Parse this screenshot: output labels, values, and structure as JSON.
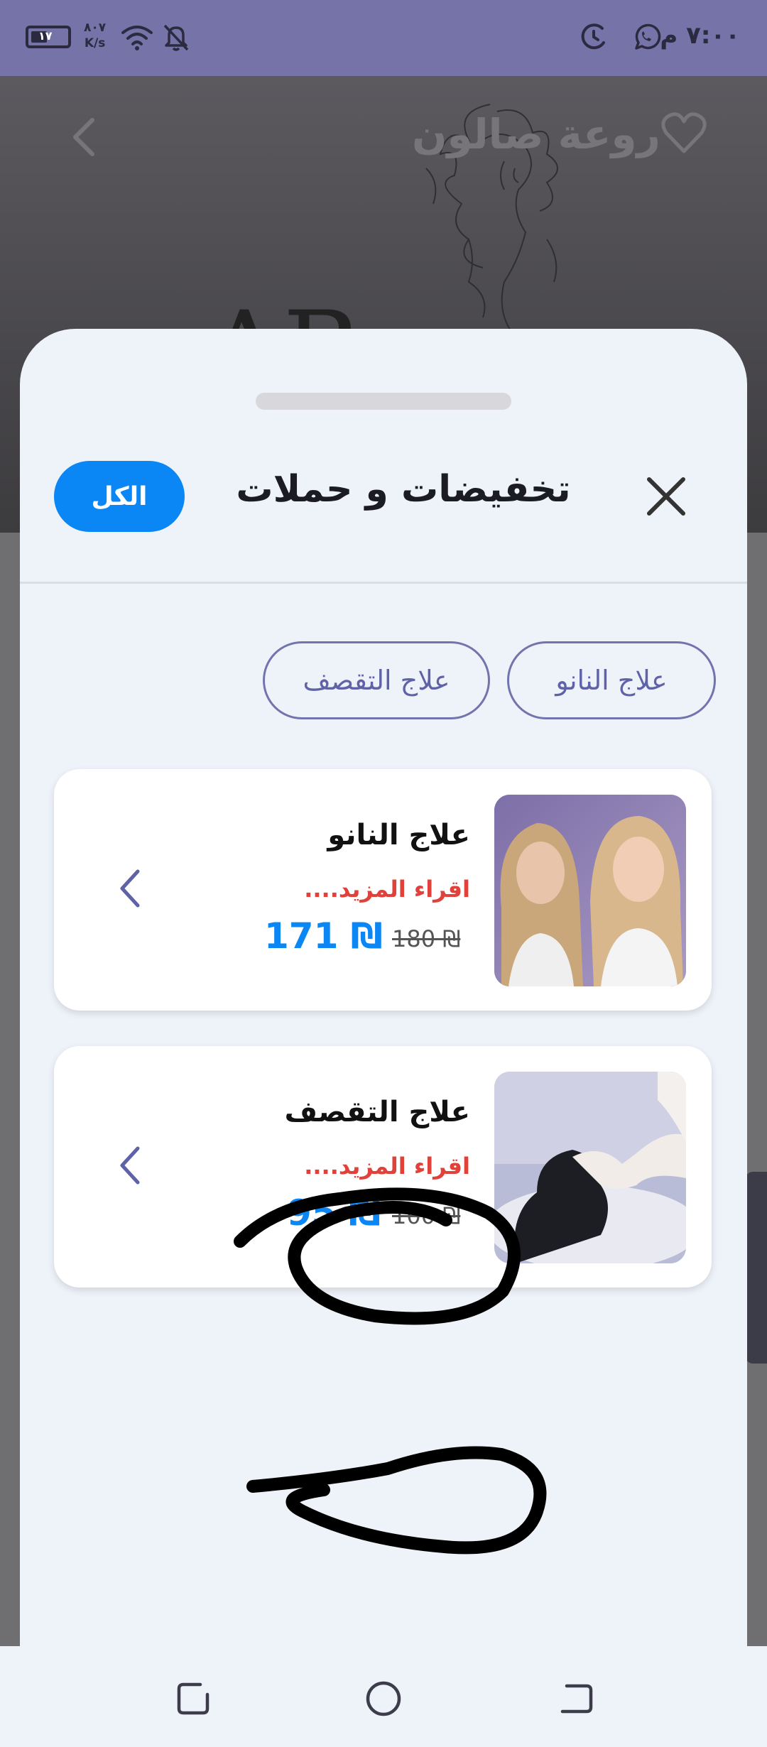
{
  "status_bar": {
    "time": "٧:٠٠ م",
    "network_speed_value": "٨٠٧",
    "network_speed_unit": "K/s",
    "battery_level": "١٧",
    "icons": [
      "battery-icon",
      "wifi-icon",
      "bell-off-icon",
      "alarm-icon",
      "whatsapp-icon"
    ]
  },
  "background_page": {
    "title": "روعة صالون",
    "logo_letters": "AB",
    "icons": [
      "heart-icon",
      "back-chevron-icon"
    ]
  },
  "sheet": {
    "title": "تخفيضات و حملات",
    "all_button_label": "الكل",
    "close_icon": "close-icon",
    "filters": [
      {
        "label": "علاج النانو"
      },
      {
        "label": "علاج التقصف"
      }
    ],
    "offers": [
      {
        "title": "علاج النانو",
        "read_more": "اقراء المزيد....",
        "old_price": "180 ₪",
        "new_price": "171 ₪",
        "image": "two-women-hair-photo"
      },
      {
        "title": "علاج التقصف",
        "read_more": "اقراء المزيد....",
        "old_price": "100 ₪",
        "new_price": "95 ₪",
        "image": "hair-washing-photo"
      }
    ]
  },
  "nav_bar": {
    "icons": [
      "recents-icon",
      "home-icon",
      "back-icon"
    ]
  },
  "colors": {
    "accent_blue": "#0a86f5",
    "chip_purple": "#7274ad",
    "read_more_red": "#e0413a",
    "status_bar": "#7573a8",
    "sheet_bg": "#eef2f9"
  }
}
